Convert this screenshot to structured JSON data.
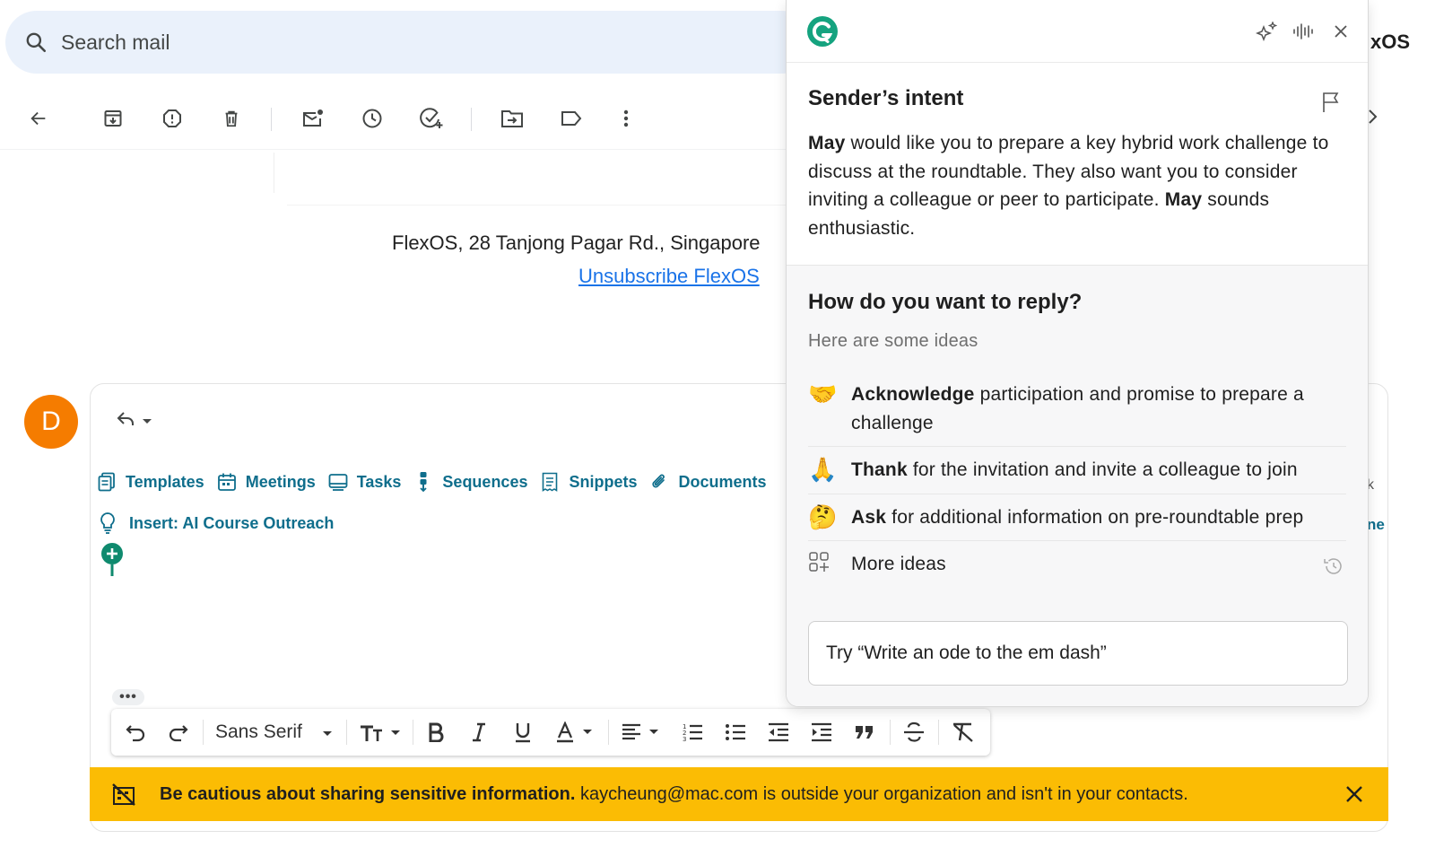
{
  "gmail": {
    "search": {
      "placeholder": "Search mail"
    },
    "partial_right_label": "xOS",
    "toolbar": {
      "icons": [
        "back-arrow-icon",
        "archive-icon",
        "report-spam-icon",
        "delete-icon",
        "mark-unread-icon",
        "snooze-icon",
        "add-to-tasks-icon",
        "move-to-icon",
        "label-icon",
        "more-vert-icon"
      ]
    },
    "email_footer": {
      "address": "FlexOS, 28 Tanjong Pagar Rd., Singapore",
      "unsubscribe": "Unsubscribe FlexOS"
    },
    "avatar_letter": "D",
    "compose": {
      "extension_bar": [
        "Templates",
        "Meetings",
        "Tasks",
        "Sequences",
        "Snippets",
        "Documents"
      ],
      "insert_label": "Insert: AI Course Outreach",
      "more_label": "•••",
      "edge_partial_1": "k",
      "edge_partial_2": "ne",
      "format_bar": {
        "font": "Sans Serif"
      }
    },
    "warning": {
      "bold": "Be cautious about sharing sensitive information.",
      "text": " kaycheung@mac.com is outside your organization and isn't in your contacts."
    },
    "colors": {
      "warning_bg": "#fbbc04",
      "avatar_bg": "#f57c00",
      "link": "#1a73e8",
      "extension": "#0f6e8c"
    }
  },
  "grammarly": {
    "brand_color": "#15a37f",
    "header_icons": [
      "sparkle-icon",
      "voice-icon",
      "close-icon"
    ],
    "intent": {
      "title": "Sender’s intent",
      "name1": "May",
      "text1": " would like you to prepare a key hybrid work challenge to discuss at the roundtable. They also want you to consider inviting a colleague or peer to participate. ",
      "name2": "May",
      "text2": " sounds enthusiastic."
    },
    "reply": {
      "title": "How do you want to reply?",
      "subtitle": "Here are some ideas",
      "ideas": [
        {
          "emoji": "🤝",
          "bold": "Acknowledge",
          "rest": " participation and promise to prepare a challenge"
        },
        {
          "emoji": "🙏",
          "bold": "Thank",
          "rest": " for the invitation and invite a colleague to join"
        },
        {
          "emoji": "🤔",
          "bold": "Ask",
          "rest": " for additional information on pre-roundtable prep"
        }
      ],
      "more": "More ideas",
      "input_placeholder": "Try “Write an ode to the em dash”"
    }
  }
}
